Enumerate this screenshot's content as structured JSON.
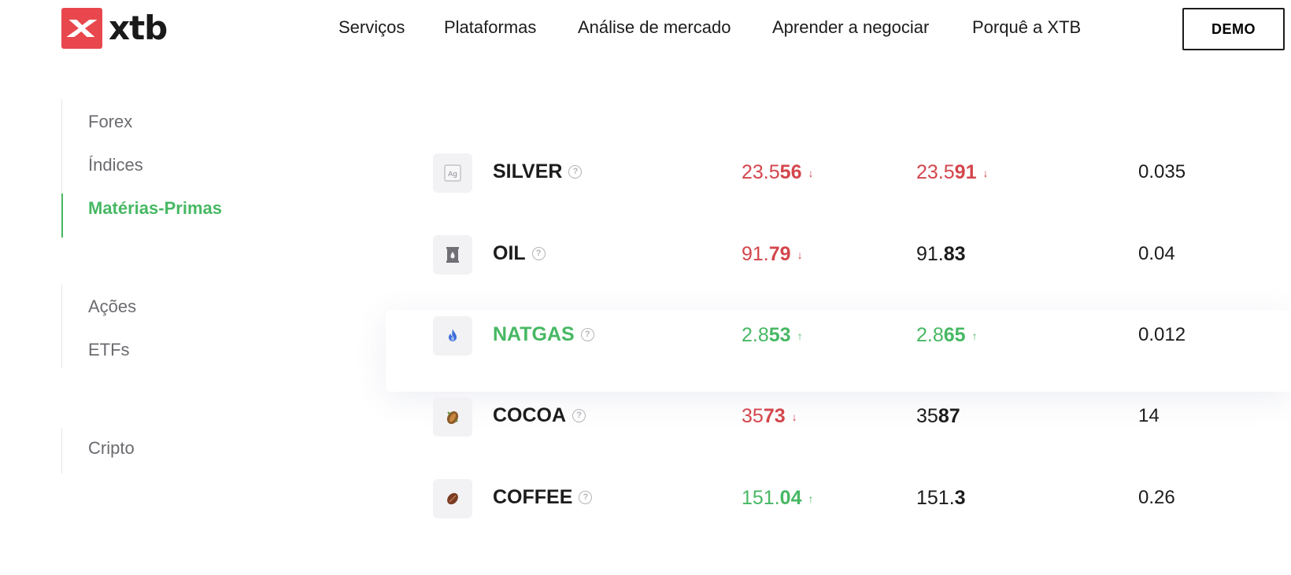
{
  "header": {
    "logo_text": "xtb",
    "nav": [
      "Serviços",
      "Plataformas",
      "Análise de mercado",
      "Aprender a negociar",
      "Porquê a XTB"
    ],
    "demo_label": "DEMO"
  },
  "sidebar": {
    "items": [
      "Forex",
      "Índices",
      "Matérias-Primas",
      "Ações",
      "ETFs",
      "Cripto"
    ],
    "active": "Matérias-Primas"
  },
  "colors": {
    "brand": "#e8474d",
    "up": "#47b864",
    "down": "#d3464c",
    "text": "#1c1c1c"
  },
  "instruments": [
    {
      "symbol": "SILVER",
      "icon": "silver-ag-icon",
      "symbol_color": "black",
      "sell": {
        "pre": "23.5",
        "bold": "56",
        "direction": "down",
        "color": "red",
        "arrow": "↓"
      },
      "buy": {
        "pre": "23.5",
        "bold": "91",
        "direction": "down",
        "color": "red",
        "arrow": "↓"
      },
      "spread": "0.035"
    },
    {
      "symbol": "OIL",
      "icon": "oil-barrel-icon",
      "symbol_color": "black",
      "sell": {
        "pre": "91.",
        "bold": "79",
        "direction": "down",
        "color": "red",
        "arrow": "↓"
      },
      "buy": {
        "pre": "91.",
        "bold": "83",
        "direction": "none",
        "color": "black",
        "arrow": ""
      },
      "spread": "0.04"
    },
    {
      "symbol": "NATGAS",
      "icon": "gas-flame-icon",
      "symbol_color": "green",
      "sell": {
        "pre": "2.8",
        "bold": "53",
        "direction": "up",
        "color": "green",
        "arrow": "↑"
      },
      "buy": {
        "pre": "2.8",
        "bold": "65",
        "direction": "up",
        "color": "green",
        "arrow": "↑"
      },
      "spread": "0.012"
    },
    {
      "symbol": "COCOA",
      "icon": "cocoa-pod-icon",
      "symbol_color": "black",
      "sell": {
        "pre": "35",
        "bold": "73",
        "direction": "down",
        "color": "red",
        "arrow": "↓"
      },
      "buy": {
        "pre": "35",
        "bold": "87",
        "direction": "none",
        "color": "black",
        "arrow": ""
      },
      "spread": "14"
    },
    {
      "symbol": "COFFEE",
      "icon": "coffee-bean-icon",
      "symbol_color": "black",
      "sell": {
        "pre": "151.",
        "bold": "04",
        "direction": "up",
        "color": "green",
        "arrow": "↑"
      },
      "buy": {
        "pre": "151.",
        "bold": "3",
        "direction": "none",
        "color": "black",
        "arrow": ""
      },
      "spread": "0.26"
    }
  ]
}
